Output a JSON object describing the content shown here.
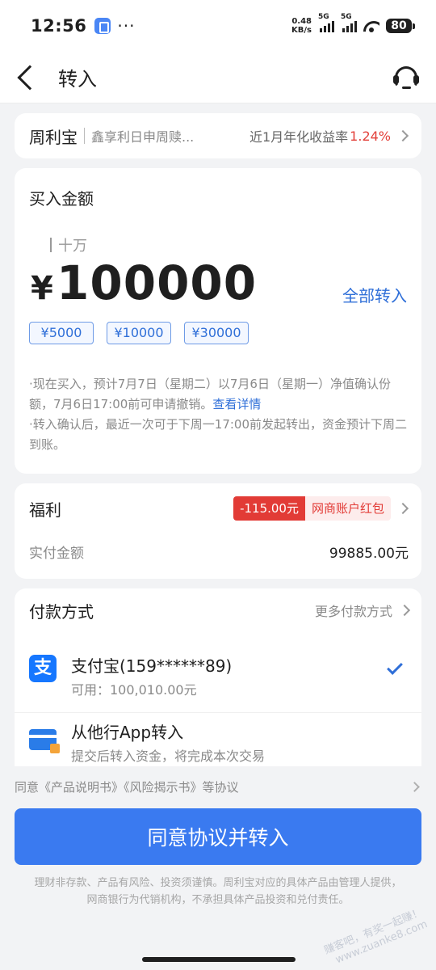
{
  "status_bar": {
    "time": "12:56",
    "dots": "···",
    "net_speed_value": "0.48",
    "net_speed_unit": "KB/s",
    "signal1_label": "5G",
    "signal2_label": "5G",
    "battery": "80"
  },
  "navbar": {
    "title": "转入"
  },
  "product": {
    "name": "周利宝",
    "desc": "鑫享利日申周赎...",
    "rate_label": "近1月年化收益率",
    "rate_value": "1.24%"
  },
  "amount": {
    "title": "买入金额",
    "unit_hint": "十万",
    "currency": "¥",
    "value": "100000",
    "all_in": "全部转入",
    "chips": [
      "¥5000",
      "¥10000",
      "¥30000"
    ],
    "notice_line1": "·现在买入，预计7月7日（星期二）以7月6日（星期一）净值确认份额，7月6日17:00前可申请撤销。",
    "notice_link": "查看详情",
    "notice_line2": "·转入确认后，最近一次可于下周一17:00前发起转出，资金预计下周二到账。"
  },
  "welfare": {
    "label": "福利",
    "coupon_amount": "-115.00元",
    "coupon_name": "网商账户红包",
    "paid_label": "实付金额",
    "paid_value": "99885.00元"
  },
  "payment": {
    "title": "付款方式",
    "more": "更多付款方式",
    "options": [
      {
        "icon_text": "支",
        "title": "支付宝(159******89)",
        "sub": "可用：100,010.00元",
        "selected": true
      },
      {
        "title": "从他行App转入",
        "sub": "提交后转入资金，将完成本次交易",
        "selected": false
      }
    ]
  },
  "agreement": {
    "text": "同意《产品说明书》《风险揭示书》等协议"
  },
  "submit": {
    "label": "同意协议并转入"
  },
  "disclaimer": {
    "line1": "理财非存款、产品有风险、投资须谨慎。周利宝对应的具体产品由管理人提供，",
    "line2": "网商银行为代销机构，不承担具体产品投资和兑付责任。"
  },
  "watermark": {
    "line1": "赚客吧，有奖一起赚！",
    "line2": "www.zuanke8.com"
  },
  "colors": {
    "accent": "#3a7af0",
    "link": "#2f6fd8",
    "red": "#e23b36",
    "background": "#f2f3f5"
  },
  "icons": [
    "back-icon",
    "customer-service-icon",
    "alipay-icon",
    "bank-card-icon",
    "check-icon",
    "chevron-right-icon"
  ]
}
